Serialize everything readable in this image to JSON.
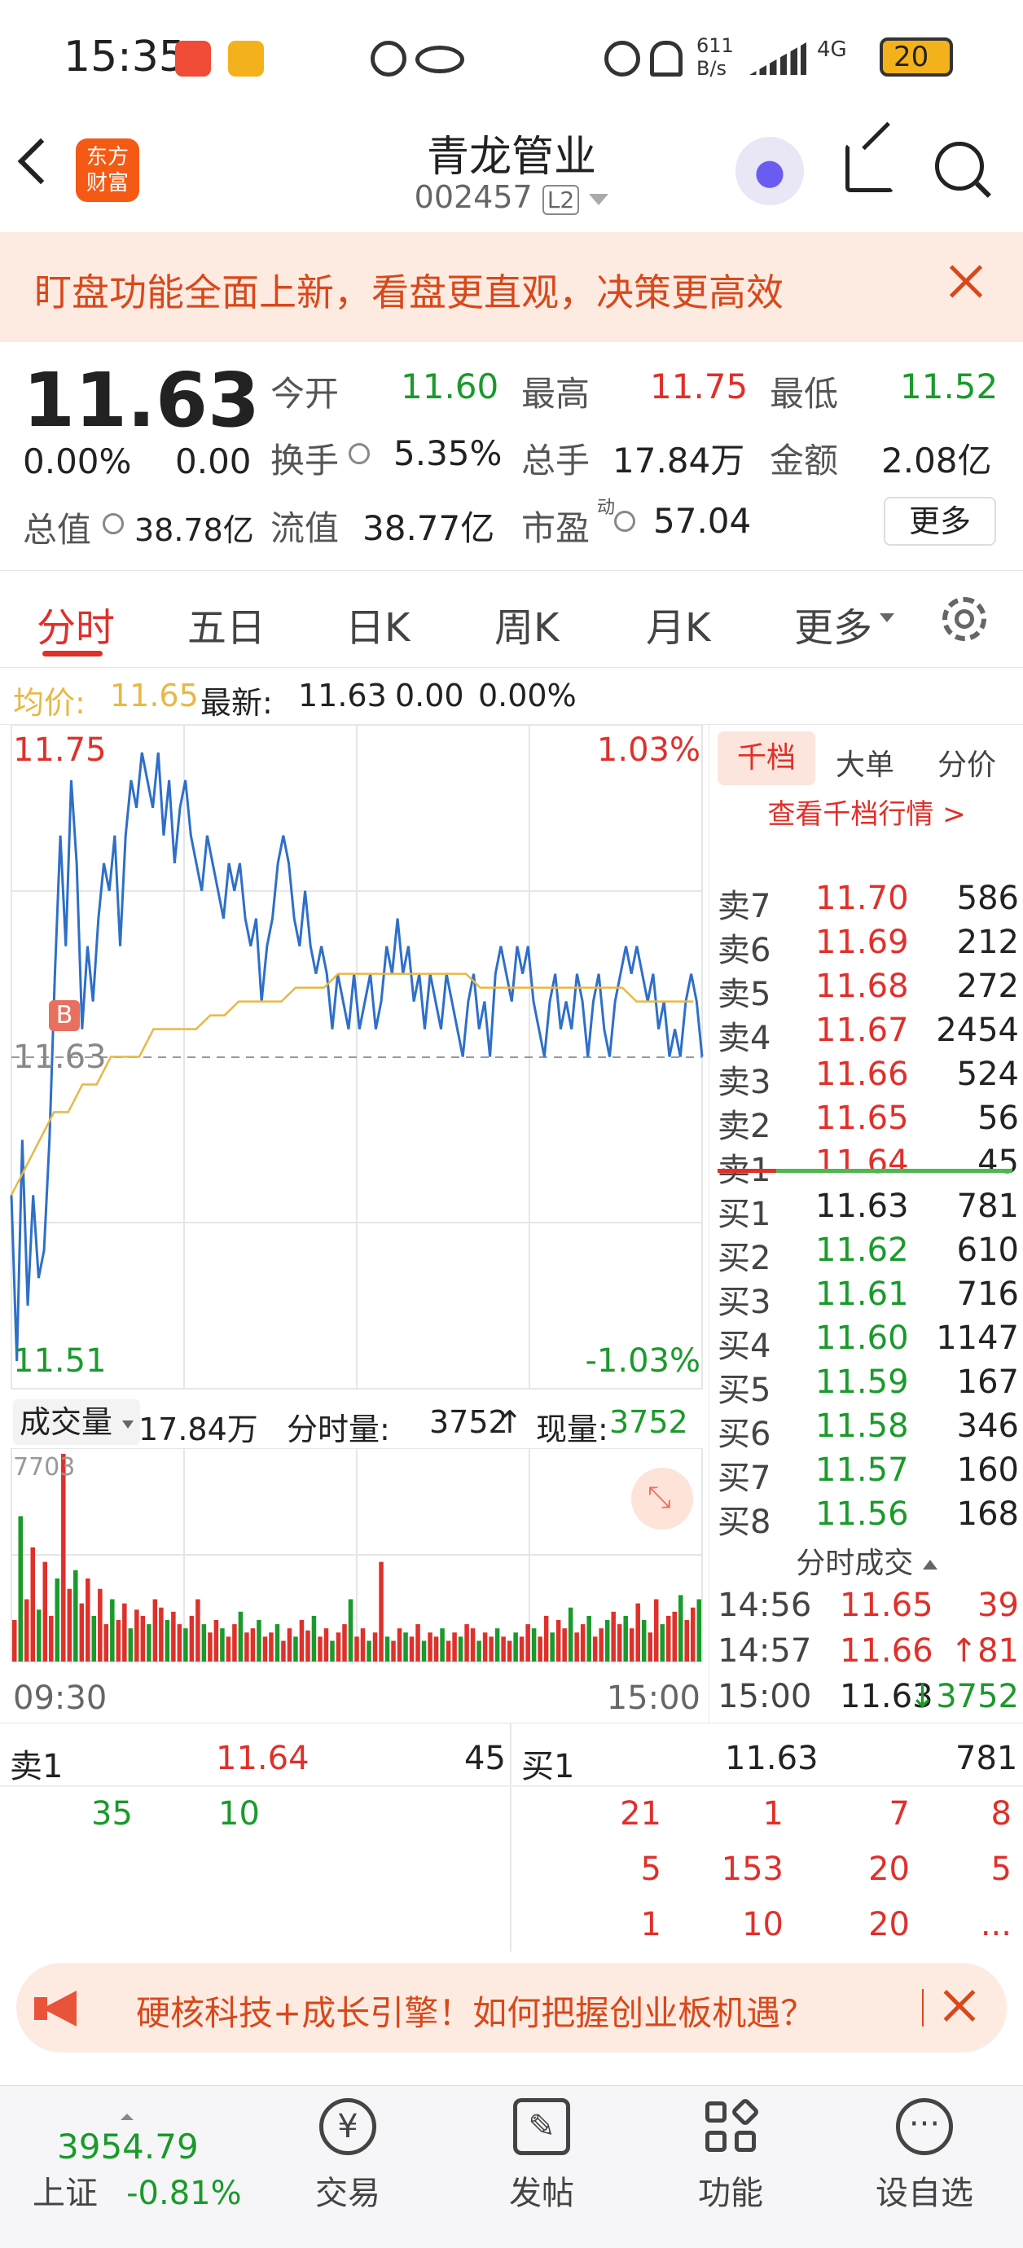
{
  "status_bar": {
    "time": "15:35",
    "net_speed_value": "611",
    "net_speed_unit": "B/s",
    "signal": "4G",
    "battery": "20"
  },
  "nav": {
    "logo_line1": "东方",
    "logo_line2": "财富",
    "title": "青龙管业",
    "code": "002457",
    "level_badge": "L2"
  },
  "banner": {
    "text": "盯盘功能全面上新，看盘更直观，决策更高效"
  },
  "quote": {
    "price": "11.63",
    "change_pct": "0.00%",
    "change": "0.00",
    "open_label": "今开",
    "open": "11.60",
    "high_label": "最高",
    "high": "11.75",
    "low_label": "最低",
    "low": "11.52",
    "turnover_label": "换手",
    "turnover": "5.35%",
    "volume_label": "总手",
    "volume": "17.84万",
    "amount_label": "金额",
    "amount": "2.08亿",
    "mcap_label": "总值",
    "mcap": "38.78亿",
    "float_label": "流值",
    "float": "38.77亿",
    "pe_label": "市盈",
    "pe_sup": "动",
    "pe": "57.04",
    "more_button": "更多"
  },
  "tabs": [
    "分时",
    "五日",
    "日K",
    "周K",
    "月K",
    "更多"
  ],
  "avg": {
    "avg_label": "均价:",
    "avg_value": "11.65",
    "latest_label": "最新:",
    "latest_value": "11.63",
    "latest_change": "0.00",
    "latest_pct": "0.00%"
  },
  "chart_labels": {
    "top_price": "11.75",
    "top_pct": "1.03%",
    "bottom_price": "11.51",
    "bottom_pct": "-1.03%",
    "mid_price": "11.63",
    "b_marker": "B"
  },
  "chart_data": {
    "type": "line",
    "ylim": [
      11.51,
      11.75
    ],
    "series": [
      {
        "values": [
          11.58,
          11.52,
          11.6,
          11.54,
          11.58,
          11.55,
          11.56,
          11.6,
          11.66,
          11.71,
          11.67,
          11.73,
          11.7,
          11.64,
          11.67,
          11.65,
          11.68,
          11.7,
          11.69,
          11.71,
          11.67,
          11.71,
          11.73,
          11.72,
          11.74,
          11.73,
          11.72,
          11.74,
          11.71,
          11.73,
          11.7,
          11.72,
          11.73,
          11.71,
          11.7,
          11.69,
          11.71,
          11.7,
          11.69,
          11.68,
          11.7,
          11.69,
          11.7,
          11.68,
          11.67,
          11.68,
          11.65,
          11.67,
          11.68,
          11.7,
          11.71,
          11.7,
          11.68,
          11.67,
          11.69,
          11.67,
          11.66,
          11.67,
          11.66,
          11.64,
          11.66,
          11.65,
          11.64,
          11.66,
          11.64,
          11.65,
          11.66,
          11.64,
          11.65,
          11.67,
          11.66,
          11.68,
          11.66,
          11.67,
          11.65,
          11.66,
          11.64,
          11.66,
          11.65,
          11.64,
          11.66,
          11.65,
          11.64,
          11.63,
          11.65,
          11.66,
          11.64,
          11.65,
          11.63,
          11.66,
          11.67,
          11.66,
          11.65,
          11.67,
          11.66,
          11.67,
          11.65,
          11.64,
          11.63,
          11.65,
          11.66,
          11.64,
          11.65,
          11.64,
          11.66,
          11.65,
          11.63,
          11.65,
          11.66,
          11.64,
          11.63,
          11.65,
          11.66,
          11.67,
          11.66,
          11.67,
          11.66,
          11.65,
          11.66,
          11.64,
          11.65,
          11.63,
          11.64,
          11.63,
          11.65,
          11.66,
          11.65,
          11.63
        ]
      },
      {
        "values": [
          11.58,
          11.59,
          11.6,
          11.61,
          11.61,
          11.62,
          11.62,
          11.63,
          11.63,
          11.63,
          11.64,
          11.64,
          11.64,
          11.64,
          11.645,
          11.645,
          11.65,
          11.65,
          11.65,
          11.65,
          11.655,
          11.655,
          11.655,
          11.66,
          11.66,
          11.66,
          11.66,
          11.66,
          11.66,
          11.66,
          11.66,
          11.66,
          11.66,
          11.655,
          11.655,
          11.655,
          11.655,
          11.655,
          11.655,
          11.655,
          11.655,
          11.655,
          11.655,
          11.655,
          11.65,
          11.65,
          11.65,
          11.65,
          11.65
        ]
      }
    ]
  },
  "volume": {
    "dropdown_label": "成交量",
    "total": "17.84万",
    "minute_label": "分时量:",
    "minute_value": "3752",
    "current_label": "现量:",
    "current_value": "3752",
    "max_label": "7703",
    "x_start": "09:30",
    "x_end": "15:00",
    "values": [
      20,
      70,
      30,
      55,
      25,
      48,
      22,
      40,
      100,
      35,
      44,
      28,
      40,
      22,
      35,
      18,
      30,
      20,
      28,
      16,
      25,
      22,
      18,
      30,
      26,
      20,
      24,
      18,
      16,
      22,
      30,
      18,
      14,
      20,
      16,
      12,
      18,
      24,
      14,
      16,
      20,
      12,
      14,
      18,
      10,
      16,
      12,
      20,
      15,
      22,
      12,
      16,
      10,
      14,
      18,
      30,
      12,
      16,
      10,
      14,
      48,
      12,
      10,
      16,
      14,
      12,
      18,
      10,
      14,
      12,
      16,
      10,
      14,
      12,
      18,
      16,
      10,
      14,
      12,
      16,
      12,
      10,
      14,
      12,
      18,
      16,
      12,
      22,
      14,
      20,
      16,
      26,
      14,
      18,
      22,
      12,
      16,
      20,
      24,
      18,
      22,
      16,
      28,
      20,
      14,
      30,
      18,
      22,
      24,
      32,
      20,
      26,
      30
    ]
  },
  "book_tabs": [
    "千档",
    "大单",
    "分价"
  ],
  "book_link": "查看千档行情 >",
  "asks": [
    {
      "label": "卖7",
      "price": "11.70",
      "qty": "586"
    },
    {
      "label": "卖6",
      "price": "11.69",
      "qty": "212"
    },
    {
      "label": "卖5",
      "price": "11.68",
      "qty": "272"
    },
    {
      "label": "卖4",
      "price": "11.67",
      "qty": "2454"
    },
    {
      "label": "卖3",
      "price": "11.66",
      "qty": "524"
    },
    {
      "label": "卖2",
      "price": "11.65",
      "qty": "56"
    },
    {
      "label": "卖1",
      "price": "11.64",
      "qty": "45"
    }
  ],
  "bids": [
    {
      "label": "买1",
      "price": "11.63",
      "qty": "781"
    },
    {
      "label": "买2",
      "price": "11.62",
      "qty": "610"
    },
    {
      "label": "买3",
      "price": "11.61",
      "qty": "716"
    },
    {
      "label": "买4",
      "price": "11.60",
      "qty": "1147"
    },
    {
      "label": "买5",
      "price": "11.59",
      "qty": "167"
    },
    {
      "label": "买6",
      "price": "11.58",
      "qty": "346"
    },
    {
      "label": "买7",
      "price": "11.57",
      "qty": "160"
    },
    {
      "label": "买8",
      "price": "11.56",
      "qty": "168"
    }
  ],
  "ticks_title": "分时成交",
  "ticks": [
    {
      "time": "14:56",
      "price": "11.65",
      "qty": "39",
      "arrow": ""
    },
    {
      "time": "14:57",
      "price": "11.66",
      "qty": "81",
      "arrow": "↑"
    },
    {
      "time": "15:00",
      "price": "11.63",
      "qty": "3752",
      "arrow": "↓"
    }
  ],
  "level1": {
    "sell_label": "卖1",
    "sell_price": "11.64",
    "sell_qty": "45",
    "buy_label": "买1",
    "buy_price": "11.63",
    "buy_qty": "781",
    "sell_orders": [
      "35",
      "10"
    ],
    "buy_orders_row1": [
      "21",
      "1",
      "7",
      "8"
    ],
    "buy_orders_row2": [
      "5",
      "153",
      "20",
      "5"
    ],
    "buy_orders_row3": [
      "1",
      "10",
      "20",
      "..."
    ]
  },
  "promo": {
    "text": "硬核科技+成长引擎！如何把握创业板机遇？"
  },
  "dock": {
    "index_value": "3954.79",
    "index_name": "上证",
    "index_pct": "-0.81%",
    "trade": "交易",
    "post": "发帖",
    "functions": "功能",
    "watch": "设自选"
  },
  "colors": {
    "accent": "#e0302a",
    "up": "#e0302a",
    "down": "#1a9a2b",
    "price_line": "#2e6fc8",
    "avg_line": "#e9b844",
    "banner_bg": "#fdebe2",
    "brand": "#f55a14"
  }
}
